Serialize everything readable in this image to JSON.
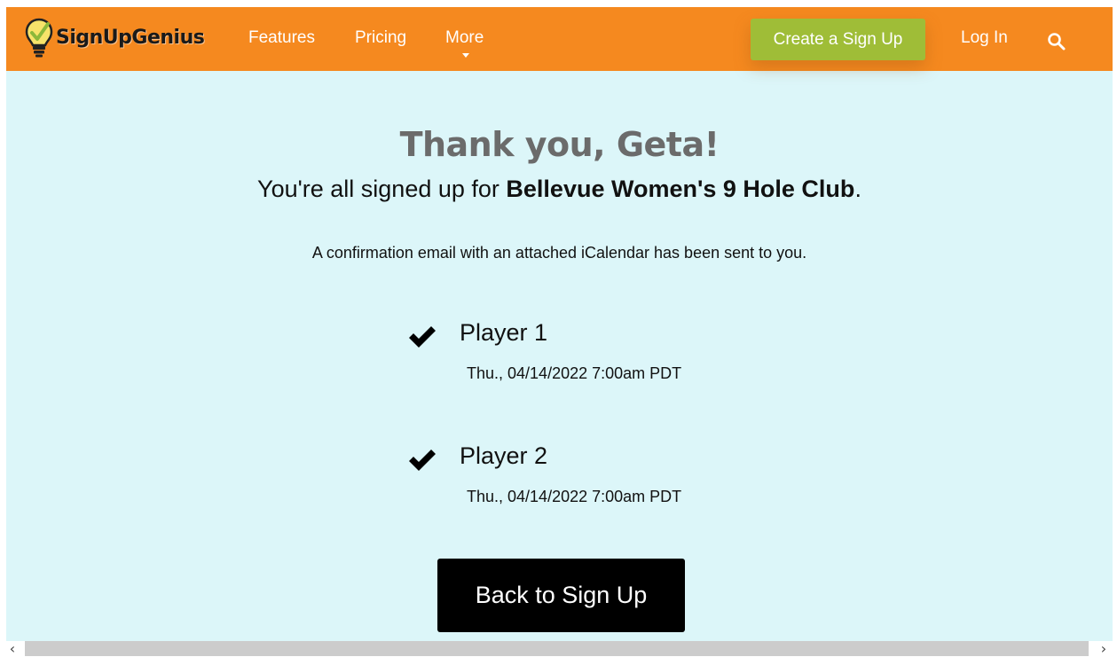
{
  "header": {
    "logo_text": "SignUpGenius",
    "nav": {
      "features": "Features",
      "pricing": "Pricing",
      "more": "More"
    },
    "create_button": "Create a Sign Up",
    "login": "Log In"
  },
  "confirmation": {
    "title": "Thank you, Geta!",
    "subtitle_prefix": "You're all signed up for ",
    "group_name": "Bellevue Women's 9 Hole Club",
    "subtitle_suffix": ".",
    "email_note": "A confirmation email with an attached iCalendar has been sent to you.",
    "slots": [
      {
        "name": "Player 1",
        "date": "Thu., 04/14/2022 7:00am PDT"
      },
      {
        "name": "Player 2",
        "date": "Thu., 04/14/2022 7:00am PDT"
      }
    ],
    "back_button": "Back to Sign Up"
  },
  "colors": {
    "header_bg": "#f5891f",
    "content_bg": "#dcf6f9",
    "create_button_bg": "#9fbd37",
    "back_button_bg": "#000000",
    "title_color": "#6b6b6b"
  },
  "icons": [
    "lightbulb-logo-icon",
    "search-icon",
    "check-icon",
    "chevron-down-icon",
    "scroll-left-icon",
    "scroll-right-icon"
  ]
}
